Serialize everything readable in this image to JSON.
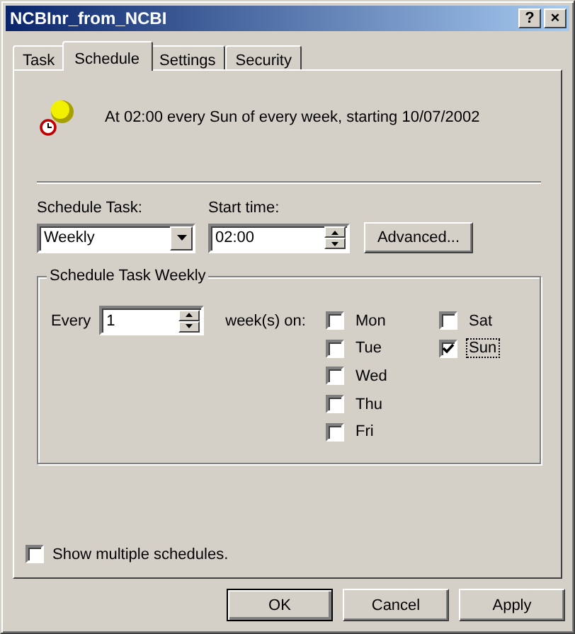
{
  "window": {
    "title": "NCBInr_from_NCBI",
    "buttons": [
      "?",
      "×"
    ]
  },
  "tabs": [
    {
      "label": "Task",
      "selected": false
    },
    {
      "label": "Schedule",
      "selected": true
    },
    {
      "label": "Settings",
      "selected": false
    },
    {
      "label": "Security",
      "selected": false
    }
  ],
  "summary": "At 02:00 every Sun of every week, starting 10/07/2002",
  "schedule_task": {
    "label": "Schedule Task:",
    "value": "Weekly"
  },
  "start_time": {
    "label": "Start time:",
    "value": "02:00"
  },
  "advanced_button": "Advanced...",
  "group": {
    "title": "Schedule Task Weekly",
    "every_label": "Every",
    "every_value": "1",
    "weeks_label": "week(s) on:",
    "days": [
      {
        "label": "Mon",
        "checked": false,
        "focused": false
      },
      {
        "label": "Tue",
        "checked": false,
        "focused": false
      },
      {
        "label": "Wed",
        "checked": false,
        "focused": false
      },
      {
        "label": "Thu",
        "checked": false,
        "focused": false
      },
      {
        "label": "Fri",
        "checked": false,
        "focused": false
      },
      {
        "label": "Sat",
        "checked": false,
        "focused": false
      },
      {
        "label": "Sun",
        "checked": true,
        "focused": true
      }
    ]
  },
  "show_multiple": {
    "label": "Show multiple schedules.",
    "checked": false
  },
  "buttons": [
    {
      "label": "OK",
      "default": true
    },
    {
      "label": "Cancel",
      "default": false
    },
    {
      "label": "Apply",
      "default": false
    }
  ]
}
